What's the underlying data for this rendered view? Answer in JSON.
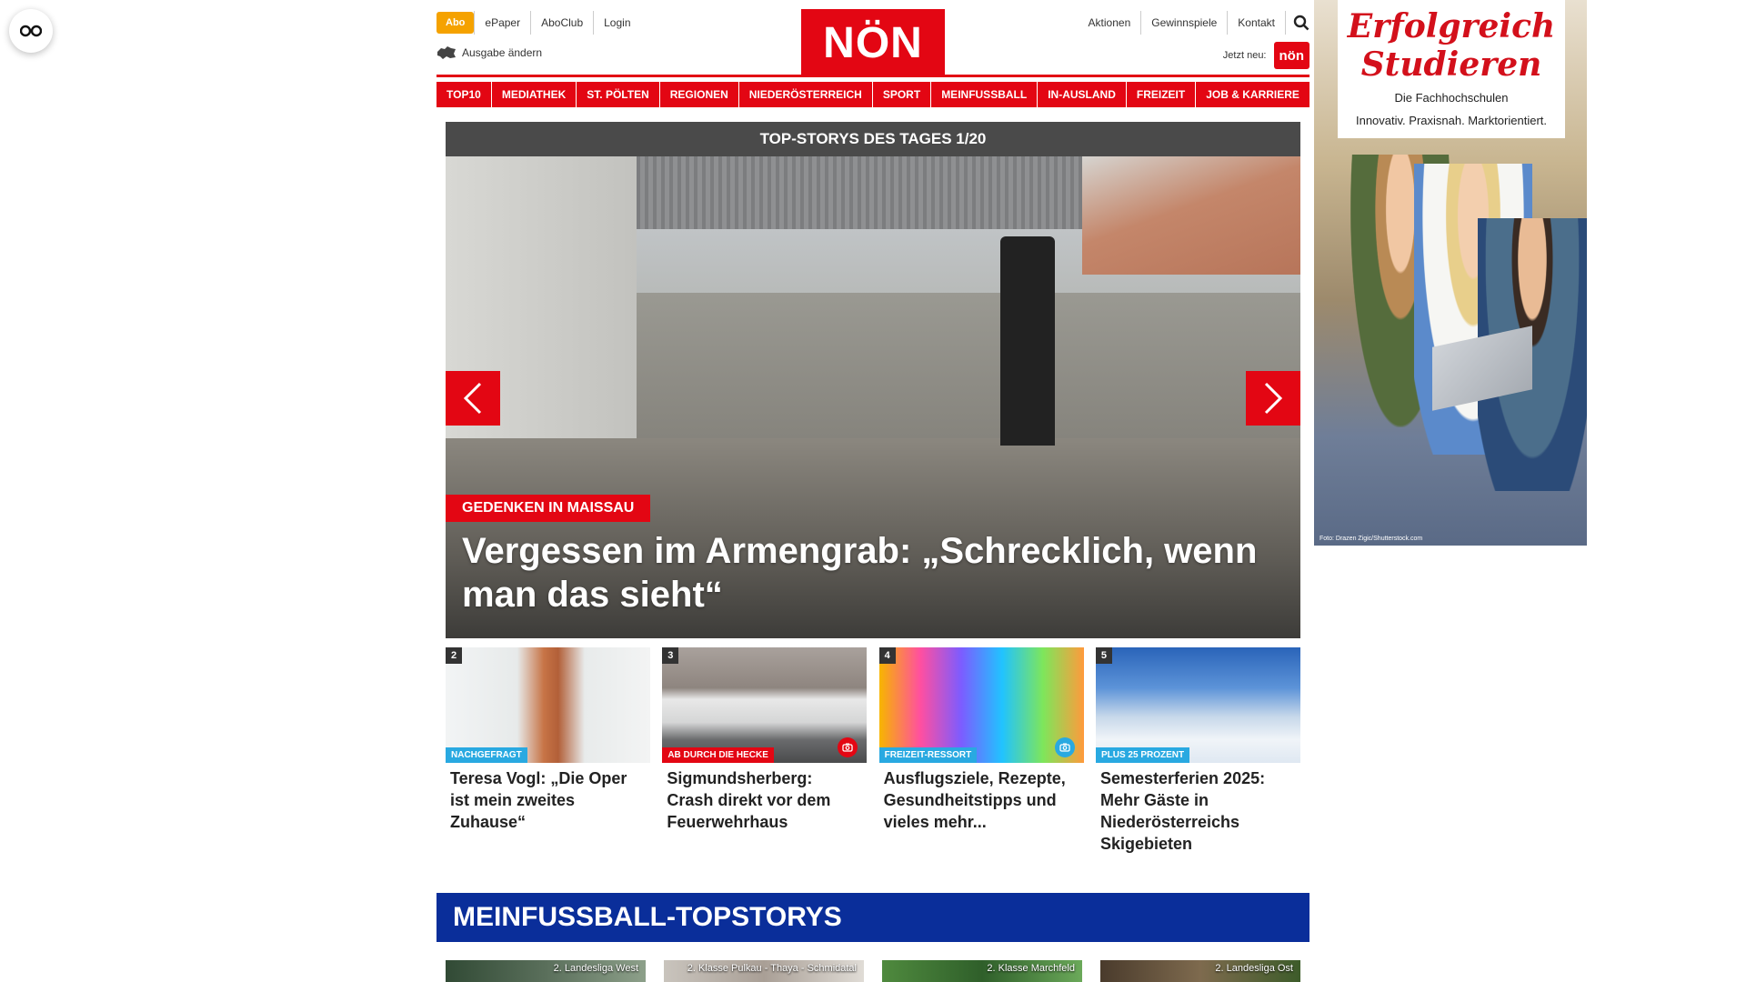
{
  "accessibility": {
    "icon": "glasses-icon"
  },
  "header": {
    "abo_label": "Abo",
    "left_links": [
      "ePaper",
      "AboClub",
      "Login"
    ],
    "edition_label": "Ausgabe ändern",
    "logo_text": "NÖN",
    "right_links": [
      "Aktionen",
      "Gewinnspiele",
      "Kontakt"
    ],
    "jetzt_neu_label": "Jetzt neu:",
    "jetzt_neu_badge": "nön"
  },
  "nav": {
    "items": [
      "TOP10",
      "MEDIATHEK",
      "ST. PÖLTEN",
      "REGIONEN",
      "NIEDERÖSTERREICH",
      "SPORT",
      "MEINFUSSBALL",
      "IN-AUSLAND",
      "FREIZEIT",
      "JOB & KARRIERE"
    ]
  },
  "top_stories": {
    "header": "TOP-STORYS DES TAGES 1/20",
    "hero": {
      "kicker": "GEDENKEN IN MAISSAU",
      "title": "Vergessen im Armengrab: „Schrecklich, wenn man das sieht“"
    },
    "cards": [
      {
        "num": "2",
        "kicker": "NACHGEFRAGT",
        "kicker_color": "#29a9e1",
        "title": "Teresa Vogl: „Die Oper ist mein zweites Zuhause“",
        "camera": false
      },
      {
        "num": "3",
        "kicker": "AB DURCH DIE HECKE",
        "kicker_color": "#e30613",
        "title": "Sigmundsherberg: Crash direkt vor dem Feuerwehrhaus",
        "camera": true,
        "camera_color": "#e30613"
      },
      {
        "num": "4",
        "kicker": "FREIZEIT-RESSORT",
        "kicker_color": "#29a9e1",
        "title": "Ausflugsziele, Rezepte, Gesundheitstipps und vieles mehr...",
        "camera": true,
        "camera_color": "#29a9e1"
      },
      {
        "num": "5",
        "kicker": "PLUS 25 PROZENT",
        "kicker_color": "#29a9e1",
        "title": "Semesterferien 2025: Mehr Gäste in Niederösterreichs Skigebieten",
        "camera": false
      }
    ]
  },
  "meinfussball": {
    "header": "MEINFUSSBALL-TOPSTORYS",
    "cards": [
      "2. Landesliga West",
      "2. Klasse Pulkau - Thaya - Schmidatal",
      "2. Klasse Marchfeld",
      "2. Landesliga Ost"
    ]
  },
  "ad": {
    "title_line1": "Erfolgreich",
    "title_line2": "Studieren",
    "sub_line1": "Die Fachhochschulen",
    "sub_line2": "Innovativ. Praxisnah. Marktorientiert.",
    "credit": "Foto: Drazen Zigic/Shutterstock.com"
  },
  "colors": {
    "brand_red": "#e30613",
    "abo_orange": "#f5a200",
    "fussball_blue": "#0a2e9a",
    "kicker_blue": "#29a9e1"
  }
}
